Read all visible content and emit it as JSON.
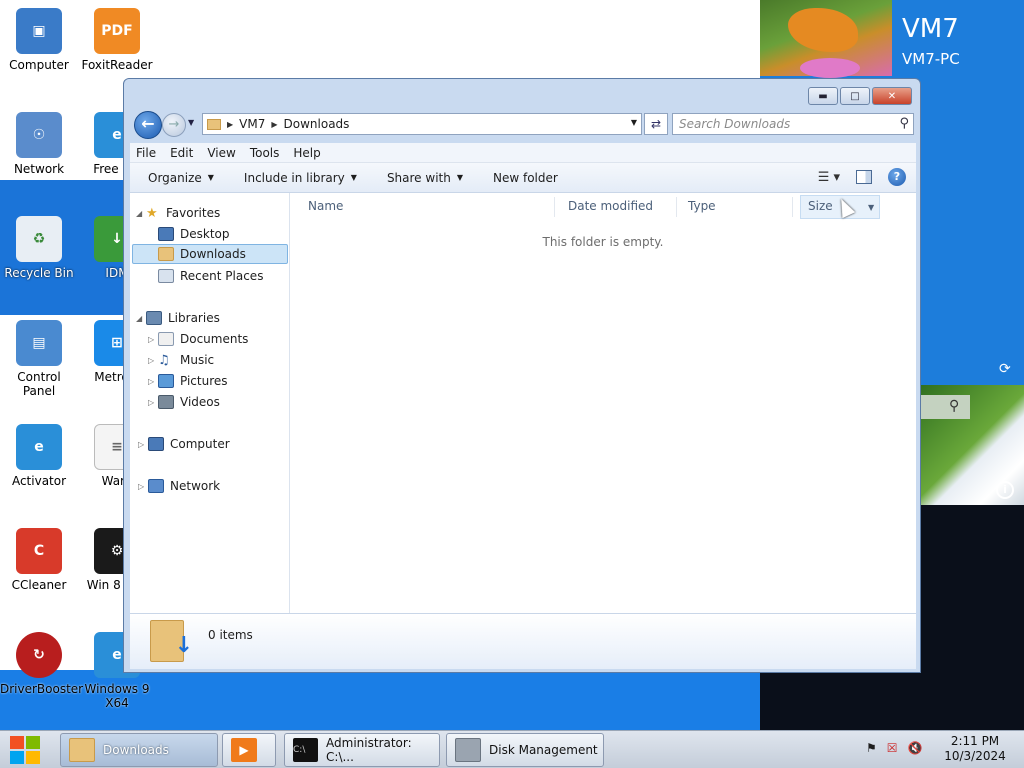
{
  "desktop": {
    "vm_tile": {
      "name": "VM7",
      "subtitle": "VM7-PC"
    },
    "icons": [
      {
        "label": "Computer"
      },
      {
        "label": "FoxitReader"
      },
      {
        "label": "Network"
      },
      {
        "label": "Free Sol"
      },
      {
        "label": "Recycle Bin"
      },
      {
        "label": "IDM"
      },
      {
        "label": "Control Panel"
      },
      {
        "label": "MetroSi"
      },
      {
        "label": "Activator"
      },
      {
        "label": "Warn"
      },
      {
        "label": "CCleaner"
      },
      {
        "label": "Win 8 Mer"
      },
      {
        "label": "DriverBooster"
      },
      {
        "label": "Windows 9 X64"
      }
    ]
  },
  "explorer": {
    "breadcrumb": [
      "VM7",
      "Downloads"
    ],
    "search_placeholder": "Search Downloads",
    "menu": [
      "File",
      "Edit",
      "View",
      "Tools",
      "Help"
    ],
    "commands": [
      "Organize",
      "Include in library",
      "Share with",
      "New folder"
    ],
    "nav": {
      "favorites": "Favorites",
      "favorites_items": [
        "Desktop",
        "Downloads",
        "Recent Places"
      ],
      "libraries": "Libraries",
      "libraries_items": [
        "Documents",
        "Music",
        "Pictures",
        "Videos"
      ],
      "computer": "Computer",
      "network": "Network"
    },
    "columns": [
      "Name",
      "Date modified",
      "Type",
      "Size"
    ],
    "empty_message": "This folder is empty.",
    "item_count": "0 items"
  },
  "taskbar": {
    "tasks": [
      "Downloads",
      "Administrator: C:\\...",
      "Disk Management"
    ],
    "time": "2:11 PM",
    "date": "10/3/2024"
  },
  "colors": {
    "accent_blue": "#1d7ddb",
    "selection": "#cce4f7"
  }
}
